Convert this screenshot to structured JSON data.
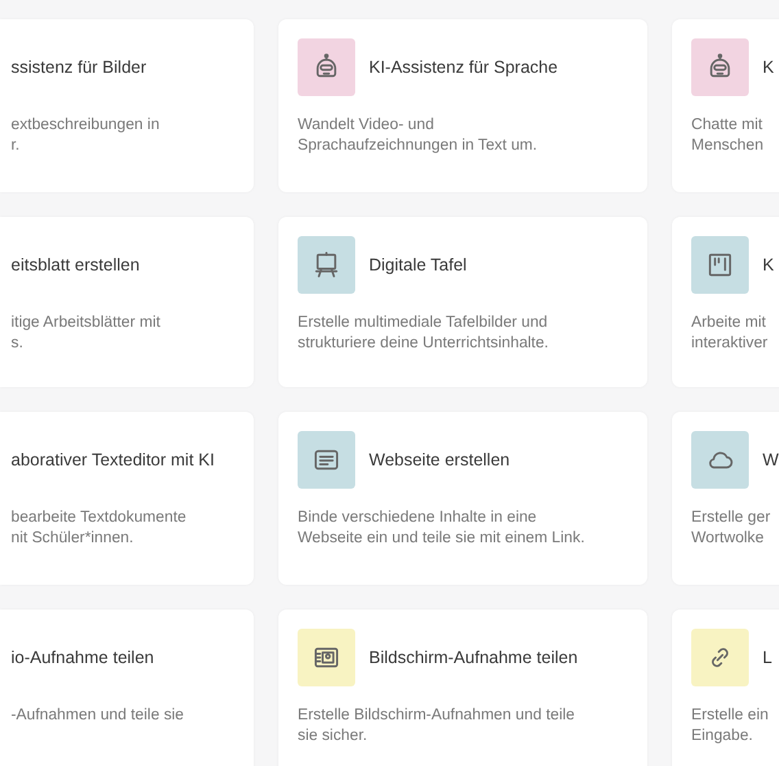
{
  "rows": [
    {
      "cards": [
        {
          "title": "ssistenz für Bilder",
          "description": [
            "extbeschreibungen in",
            "r."
          ]
        },
        {
          "kind": "robot",
          "color": "#f2d4e1",
          "title": "KI-Assistenz für Sprache",
          "description": [
            "Wandelt Video- und",
            "Sprachaufzeichnungen in Text um."
          ]
        },
        {
          "kind": "robot",
          "color": "#f2d4e1",
          "title": "K",
          "description": [
            "Chatte mit",
            "Menschen"
          ]
        }
      ]
    },
    {
      "cards": [
        {
          "title": "eitsblatt erstellen",
          "description": [
            "itige Arbeitsblätter mit",
            "s."
          ]
        },
        {
          "kind": "easel",
          "color": "#c6dee3",
          "title": "Digitale Tafel",
          "description": [
            "Erstelle multimediale Tafelbilder und",
            "strukturiere deine Unterrichtsinhalte."
          ]
        },
        {
          "kind": "board",
          "color": "#c6dee3",
          "title": "K",
          "description": [
            "Arbeite mit",
            "interaktiver"
          ]
        }
      ]
    },
    {
      "cards": [
        {
          "title": "aborativer Texteditor mit KI",
          "description": [
            "bearbeite Textdokumente",
            "nit Schüler*innen."
          ]
        },
        {
          "kind": "document",
          "color": "#c6dee3",
          "title": "Webseite erstellen",
          "description": [
            "Binde verschiedene Inhalte in eine",
            "Webseite ein und teile sie mit einem Link."
          ]
        },
        {
          "kind": "cloud",
          "color": "#c6dee3",
          "title": "W",
          "description": [
            "Erstelle ger",
            "Wortwolke"
          ]
        }
      ]
    },
    {
      "cards": [
        {
          "title": "io-Aufnahme teilen",
          "description": [
            "-Aufnahmen und teile sie"
          ]
        },
        {
          "kind": "idcard",
          "color": "#f8f3c2",
          "title": "Bildschirm-Aufnahme teilen",
          "description": [
            "Erstelle Bildschirm-Aufnahmen und teile",
            "sie sicher."
          ]
        },
        {
          "kind": "link",
          "color": "#f8f3c2",
          "title": "L",
          "description": [
            "Erstelle ein",
            "Eingabe."
          ]
        }
      ]
    }
  ]
}
